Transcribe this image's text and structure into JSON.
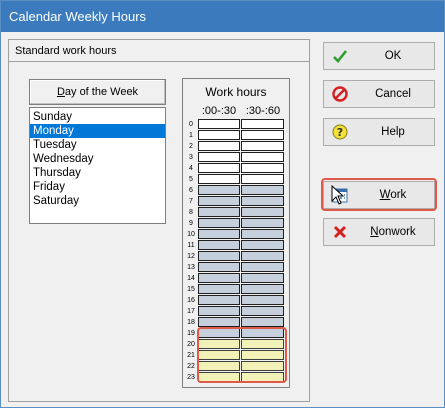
{
  "window": {
    "title": "Calendar Weekly Hours"
  },
  "group": {
    "title": "Standard work hours"
  },
  "day_of_week": {
    "header_prefix": "",
    "header_underlined": "D",
    "header_rest": "ay of the Week",
    "items": [
      "Sunday",
      "Monday",
      "Tuesday",
      "Wednesday",
      "Thursday",
      "Friday",
      "Saturday"
    ],
    "selected_index": 1
  },
  "work_hours": {
    "title": "Work hours",
    "col1": ":00-:30",
    "col2": ":30-:60",
    "hours": [
      {
        "label": "0",
        "state": "nonwork"
      },
      {
        "label": "1",
        "state": "nonwork"
      },
      {
        "label": "2",
        "state": "nonwork"
      },
      {
        "label": "3",
        "state": "nonwork"
      },
      {
        "label": "4",
        "state": "nonwork"
      },
      {
        "label": "5",
        "state": "nonwork"
      },
      {
        "label": "6",
        "state": "work"
      },
      {
        "label": "7",
        "state": "work"
      },
      {
        "label": "8",
        "state": "work"
      },
      {
        "label": "9",
        "state": "work"
      },
      {
        "label": "10",
        "state": "work"
      },
      {
        "label": "11",
        "state": "work"
      },
      {
        "label": "12",
        "state": "work"
      },
      {
        "label": "13",
        "state": "work"
      },
      {
        "label": "14",
        "state": "work"
      },
      {
        "label": "15",
        "state": "work"
      },
      {
        "label": "16",
        "state": "work"
      },
      {
        "label": "17",
        "state": "work"
      },
      {
        "label": "18",
        "state": "work"
      },
      {
        "label": "19",
        "state": "work"
      },
      {
        "label": "20",
        "state": "selected"
      },
      {
        "label": "21",
        "state": "selected"
      },
      {
        "label": "22",
        "state": "selected"
      },
      {
        "label": "23",
        "state": "selected"
      }
    ]
  },
  "buttons": {
    "ok": {
      "pre": "",
      "ul": "",
      "post": "OK"
    },
    "cancel": {
      "pre": "",
      "ul": "",
      "post": "Cancel"
    },
    "help": {
      "pre": "",
      "ul": "",
      "post": "Help"
    },
    "work": {
      "pre": "",
      "ul": "W",
      "post": "ork"
    },
    "nonwork": {
      "pre": "",
      "ul": "N",
      "post": "onwork"
    }
  },
  "colors": {
    "titlebar": "#3b7bbd",
    "work_cell": "#c6d0dc",
    "selected_cell": "#f2f2b8",
    "highlight": "#e05a4a"
  }
}
